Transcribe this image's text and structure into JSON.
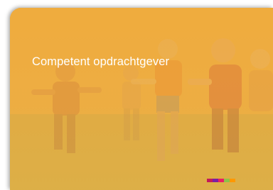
{
  "card": {
    "title": "Competent opdrachtgever"
  },
  "colors": {
    "tint": "#f3b040",
    "title_text": "#ffffff",
    "logo_strip": [
      "#c2185b",
      "#7b1fa2",
      "#e91e63",
      "#8bc34a",
      "#ff9800"
    ]
  },
  "image": {
    "subject": "children-running-in-field-photo"
  }
}
